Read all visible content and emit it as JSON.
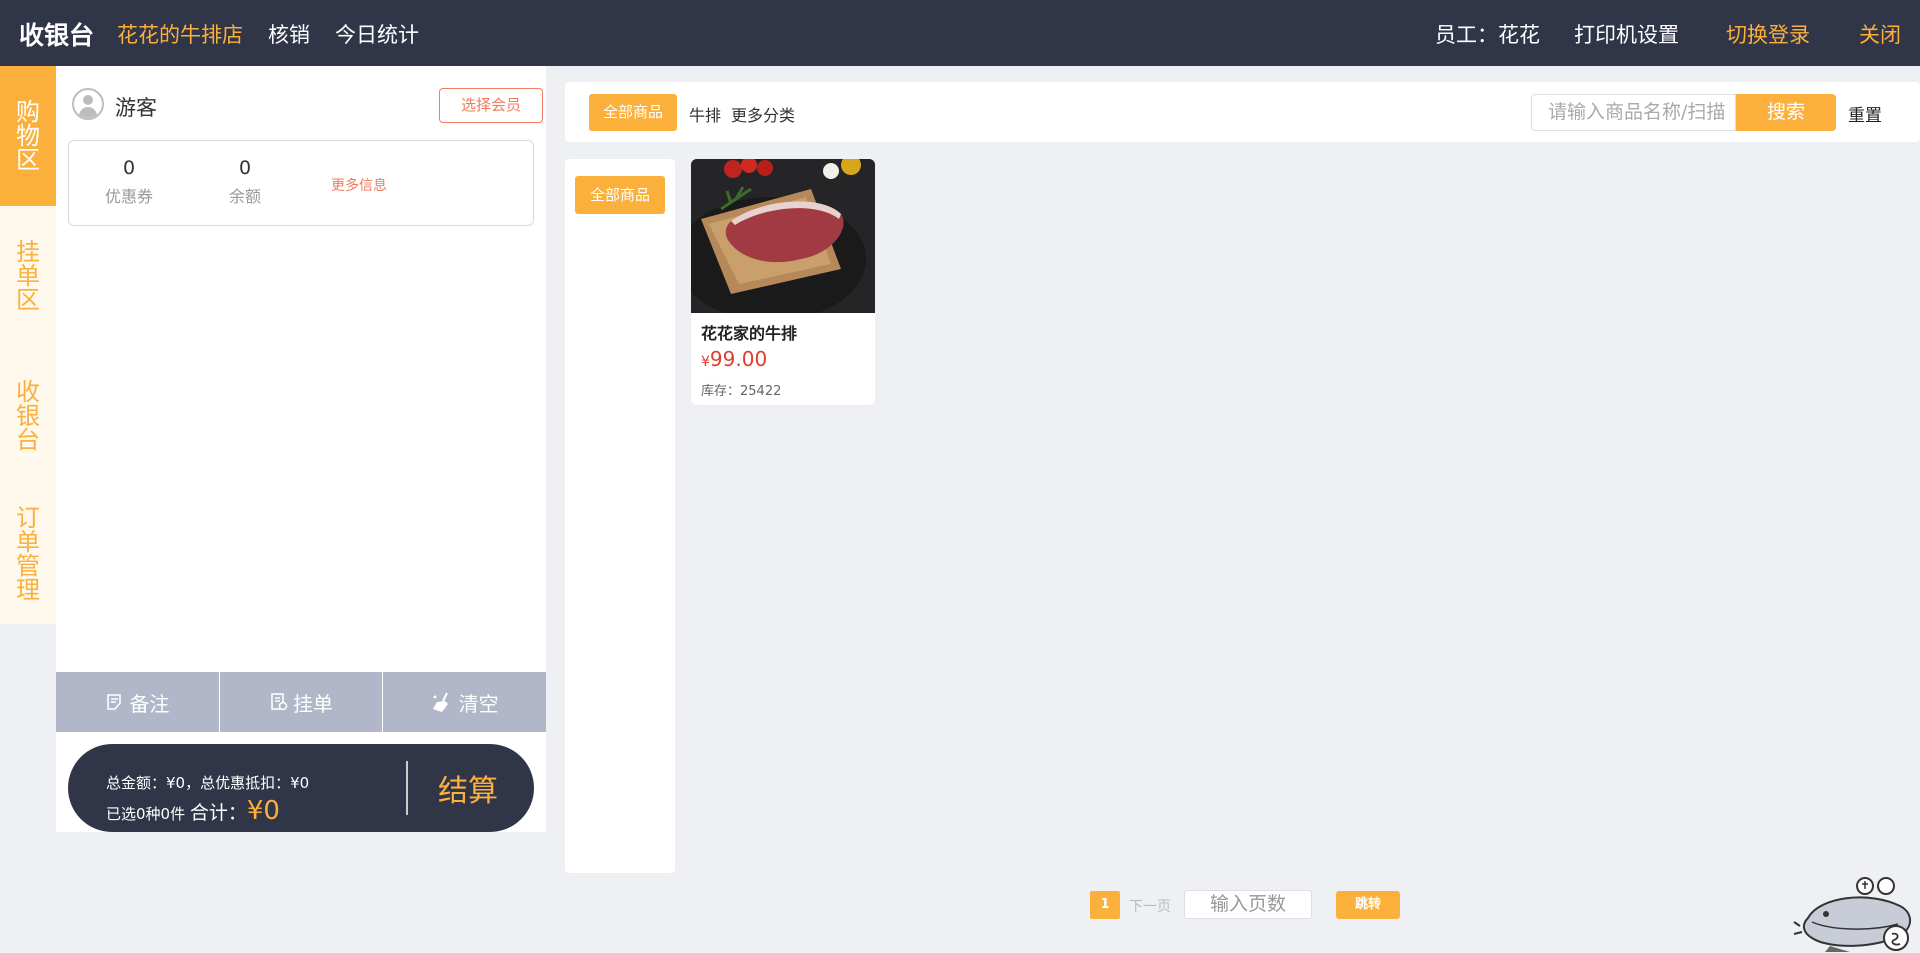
{
  "header": {
    "brand": "收银台",
    "nav": [
      "花花的牛排店",
      "核销",
      "今日统计"
    ],
    "employee": "员工：花花",
    "printer_settings": "打印机设置",
    "switch_login": "切换登录",
    "close": "关闭"
  },
  "side_tabs": [
    "购物区",
    "挂单区",
    "收银台",
    "订单管理"
  ],
  "member": {
    "name": "游客",
    "select_button": "选择会员",
    "coupons_value": "0",
    "coupons_label": "优惠券",
    "balance_value": "0",
    "balance_label": "余额",
    "more_info": "更多信息"
  },
  "cart_actions": {
    "note": "备注",
    "hold": "挂单",
    "clear": "清空"
  },
  "checkout": {
    "line1": "总金额：¥0，总优惠抵扣：¥0",
    "selected": "已选0种0件",
    "total_label": "合计：",
    "total_value": "¥0",
    "button": "结算"
  },
  "filter": {
    "all_button": "全部商品",
    "categories": [
      "牛排",
      "更多分类"
    ],
    "search_placeholder": "请输入商品名称/扫描",
    "search_button": "搜索",
    "reset_button": "重置"
  },
  "category_sidebar": {
    "all_button": "全部商品"
  },
  "products": [
    {
      "name": "花花家的牛排",
      "currency": "¥",
      "price": "99.00",
      "stock": "库存：25422"
    }
  ],
  "pagination": {
    "current_page": "1",
    "next": "下一页",
    "page_input_placeholder": "输入页数",
    "go": "跳转"
  },
  "colors": {
    "header_bg": "#303548",
    "accent": "#fbb03b",
    "price_red": "#e03c2f",
    "action_bar": "#b1b6c8",
    "page_bg": "#eef0f3"
  }
}
